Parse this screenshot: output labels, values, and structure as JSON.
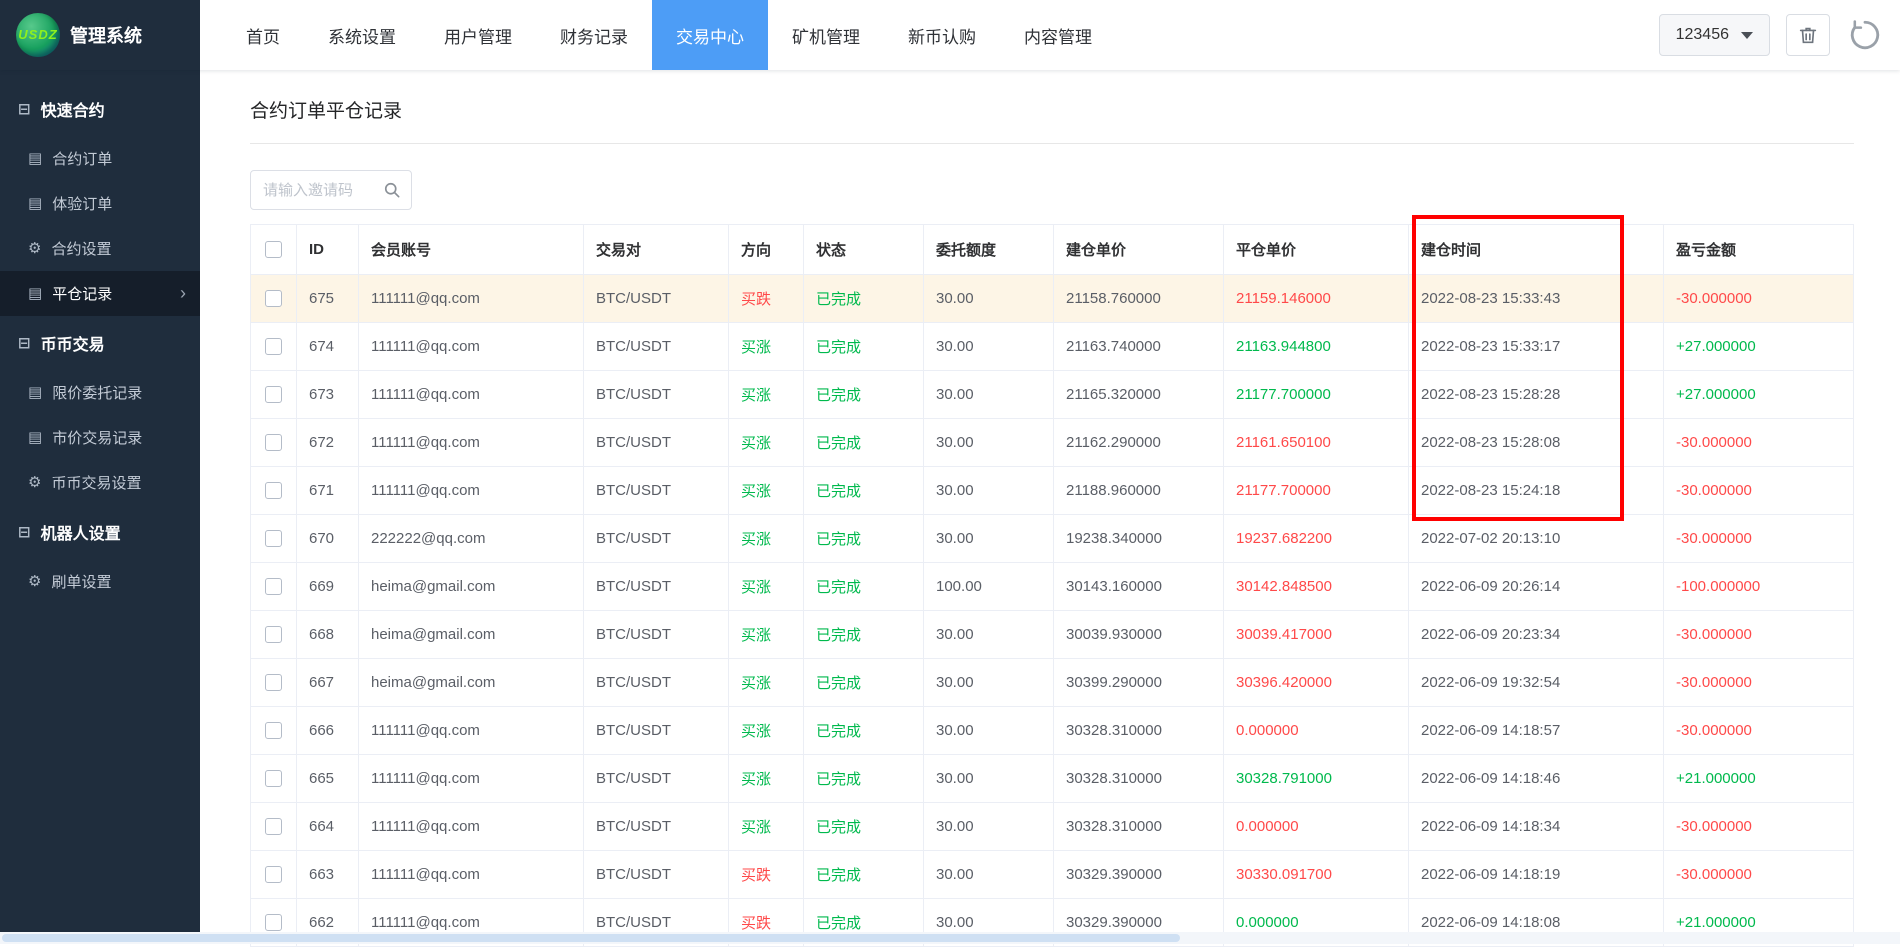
{
  "colors": {
    "red": "#ff4949",
    "green": "#00b94d",
    "accent": "#4d9df6",
    "annotation": "#ff0000",
    "highlight_row": "#fdf5e6"
  },
  "brand": {
    "logo": "USDZ",
    "title": "管理系统"
  },
  "topnav": {
    "items": [
      "首页",
      "系统设置",
      "用户管理",
      "财务记录",
      "交易中心",
      "矿机管理",
      "新币认购",
      "内容管理"
    ],
    "active": "交易中心",
    "user_select": "123456"
  },
  "sidebar": {
    "sections": [
      {
        "title": "快速合约",
        "items": [
          {
            "label": "合约订单",
            "icon": "list"
          },
          {
            "label": "体验订单",
            "icon": "list"
          },
          {
            "label": "合约设置",
            "icon": "gear"
          },
          {
            "label": "平仓记录",
            "icon": "list",
            "active": true
          }
        ]
      },
      {
        "title": "币币交易",
        "items": [
          {
            "label": "限价委托记录",
            "icon": "list"
          },
          {
            "label": "市价交易记录",
            "icon": "list"
          },
          {
            "label": "币币交易设置",
            "icon": "gear"
          }
        ]
      },
      {
        "title": "机器人设置",
        "items": [
          {
            "label": "刷单设置",
            "icon": "gear"
          }
        ]
      }
    ]
  },
  "main": {
    "page_title": "合约订单平仓记录",
    "search": {
      "placeholder": "请输入邀请码"
    },
    "table": {
      "columns": [
        "ID",
        "会员账号",
        "交易对",
        "方向",
        "状态",
        "委托额度",
        "建仓单价",
        "平仓单价",
        "建仓时间",
        "盈亏金额"
      ],
      "rows": [
        {
          "id": "675",
          "account": "111111@qq.com",
          "pair": "BTC/USDT",
          "direction": "买跌",
          "direction_color": "red",
          "status": "已完成",
          "status_color": "green",
          "amount": "30.00",
          "open_price": "21158.760000",
          "close_price": "21159.146000",
          "close_color": "red",
          "open_time": "2022-08-23 15:33:43",
          "pnl": "-30.000000",
          "pnl_color": "red",
          "highlight": true
        },
        {
          "id": "674",
          "account": "111111@qq.com",
          "pair": "BTC/USDT",
          "direction": "买涨",
          "direction_color": "green",
          "status": "已完成",
          "status_color": "green",
          "amount": "30.00",
          "open_price": "21163.740000",
          "close_price": "21163.944800",
          "close_color": "green",
          "open_time": "2022-08-23 15:33:17",
          "pnl": "+27.000000",
          "pnl_color": "green"
        },
        {
          "id": "673",
          "account": "111111@qq.com",
          "pair": "BTC/USDT",
          "direction": "买涨",
          "direction_color": "green",
          "status": "已完成",
          "status_color": "green",
          "amount": "30.00",
          "open_price": "21165.320000",
          "close_price": "21177.700000",
          "close_color": "green",
          "open_time": "2022-08-23 15:28:28",
          "pnl": "+27.000000",
          "pnl_color": "green"
        },
        {
          "id": "672",
          "account": "111111@qq.com",
          "pair": "BTC/USDT",
          "direction": "买涨",
          "direction_color": "green",
          "status": "已完成",
          "status_color": "green",
          "amount": "30.00",
          "open_price": "21162.290000",
          "close_price": "21161.650100",
          "close_color": "red",
          "open_time": "2022-08-23 15:28:08",
          "pnl": "-30.000000",
          "pnl_color": "red"
        },
        {
          "id": "671",
          "account": "111111@qq.com",
          "pair": "BTC/USDT",
          "direction": "买涨",
          "direction_color": "green",
          "status": "已完成",
          "status_color": "green",
          "amount": "30.00",
          "open_price": "21188.960000",
          "close_price": "21177.700000",
          "close_color": "red",
          "open_time": "2022-08-23 15:24:18",
          "pnl": "-30.000000",
          "pnl_color": "red"
        },
        {
          "id": "670",
          "account": "222222@qq.com",
          "pair": "BTC/USDT",
          "direction": "买涨",
          "direction_color": "green",
          "status": "已完成",
          "status_color": "green",
          "amount": "30.00",
          "open_price": "19238.340000",
          "close_price": "19237.682200",
          "close_color": "red",
          "open_time": "2022-07-02 20:13:10",
          "pnl": "-30.000000",
          "pnl_color": "red"
        },
        {
          "id": "669",
          "account": "heima@gmail.com",
          "pair": "BTC/USDT",
          "direction": "买涨",
          "direction_color": "green",
          "status": "已完成",
          "status_color": "green",
          "amount": "100.00",
          "open_price": "30143.160000",
          "close_price": "30142.848500",
          "close_color": "red",
          "open_time": "2022-06-09 20:26:14",
          "pnl": "-100.000000",
          "pnl_color": "red"
        },
        {
          "id": "668",
          "account": "heima@gmail.com",
          "pair": "BTC/USDT",
          "direction": "买涨",
          "direction_color": "green",
          "status": "已完成",
          "status_color": "green",
          "amount": "30.00",
          "open_price": "30039.930000",
          "close_price": "30039.417000",
          "close_color": "red",
          "open_time": "2022-06-09 20:23:34",
          "pnl": "-30.000000",
          "pnl_color": "red"
        },
        {
          "id": "667",
          "account": "heima@gmail.com",
          "pair": "BTC/USDT",
          "direction": "买涨",
          "direction_color": "green",
          "status": "已完成",
          "status_color": "green",
          "amount": "30.00",
          "open_price": "30399.290000",
          "close_price": "30396.420000",
          "close_color": "red",
          "open_time": "2022-06-09 19:32:54",
          "pnl": "-30.000000",
          "pnl_color": "red"
        },
        {
          "id": "666",
          "account": "111111@qq.com",
          "pair": "BTC/USDT",
          "direction": "买涨",
          "direction_color": "green",
          "status": "已完成",
          "status_color": "green",
          "amount": "30.00",
          "open_price": "30328.310000",
          "close_price": "0.000000",
          "close_color": "red",
          "open_time": "2022-06-09 14:18:57",
          "pnl": "-30.000000",
          "pnl_color": "red"
        },
        {
          "id": "665",
          "account": "111111@qq.com",
          "pair": "BTC/USDT",
          "direction": "买涨",
          "direction_color": "green",
          "status": "已完成",
          "status_color": "green",
          "amount": "30.00",
          "open_price": "30328.310000",
          "close_price": "30328.791000",
          "close_color": "green",
          "open_time": "2022-06-09 14:18:46",
          "pnl": "+21.000000",
          "pnl_color": "green"
        },
        {
          "id": "664",
          "account": "111111@qq.com",
          "pair": "BTC/USDT",
          "direction": "买涨",
          "direction_color": "green",
          "status": "已完成",
          "status_color": "green",
          "amount": "30.00",
          "open_price": "30328.310000",
          "close_price": "0.000000",
          "close_color": "red",
          "open_time": "2022-06-09 14:18:34",
          "pnl": "-30.000000",
          "pnl_color": "red"
        },
        {
          "id": "663",
          "account": "111111@qq.com",
          "pair": "BTC/USDT",
          "direction": "买跌",
          "direction_color": "red",
          "status": "已完成",
          "status_color": "green",
          "amount": "30.00",
          "open_price": "30329.390000",
          "close_price": "30330.091700",
          "close_color": "red",
          "open_time": "2022-06-09 14:18:19",
          "pnl": "-30.000000",
          "pnl_color": "red"
        },
        {
          "id": "662",
          "account": "111111@qq.com",
          "pair": "BTC/USDT",
          "direction": "买跌",
          "direction_color": "red",
          "status": "已完成",
          "status_color": "green",
          "amount": "30.00",
          "open_price": "30329.390000",
          "close_price": "0.000000",
          "close_color": "green",
          "open_time": "2022-06-09 14:18:08",
          "pnl": "+21.000000",
          "pnl_color": "green"
        }
      ]
    },
    "annotation": {
      "target_column": "建仓时间"
    }
  }
}
